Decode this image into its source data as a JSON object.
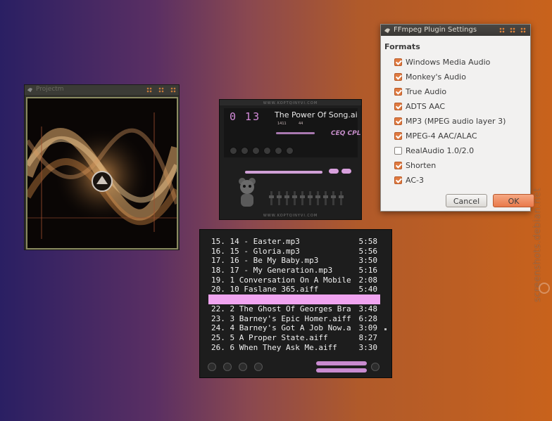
{
  "visualizer": {
    "title": "Projectm"
  },
  "player": {
    "brand_top": "WWW.KOPTQINYVI.COM",
    "brand_bottom": "WWW.KOPTQINYVI.COM",
    "time": "0 13",
    "song": "The Power Of Song.aiff",
    "kbps": "1411",
    "khz": "44",
    "mode": "CEQ CPL"
  },
  "playlist": {
    "items": [
      {
        "title": "15. 14 - Easter.mp3",
        "duration": "5:58"
      },
      {
        "title": "16. 15 - Gloria.mp3",
        "duration": "5:56"
      },
      {
        "title": "17. 16 - Be My Baby.mp3",
        "duration": "3:50"
      },
      {
        "title": "18. 17 - My Generation.mp3",
        "duration": "5:16"
      },
      {
        "title": "19. 1 Conversation On A Mobile...",
        "duration": "2:08"
      },
      {
        "title": "20. 10 Faslane 365.aiff",
        "duration": "5:40"
      },
      {
        "title": "",
        "duration": ""
      },
      {
        "title": "22. 2 The Ghost Of Georges Bra...",
        "duration": "3:48"
      },
      {
        "title": "23. 3 Barney's Epic Homer.aiff",
        "duration": "6:28"
      },
      {
        "title": "24. 4 Barney's Got A Job Now.a...",
        "duration": "3:09"
      },
      {
        "title": "25. 5 A Proper State.aiff",
        "duration": "8:27"
      },
      {
        "title": "26. 6 When They Ask Me.aiff",
        "duration": "3:30"
      }
    ],
    "selected_index": 6
  },
  "dialog": {
    "title": "FFmpeg Plugin Settings",
    "heading": "Formats",
    "formats": [
      {
        "label": "Windows Media Audio",
        "checked": true
      },
      {
        "label": "Monkey's Audio",
        "checked": true
      },
      {
        "label": "True Audio",
        "checked": true
      },
      {
        "label": "ADTS AAC",
        "checked": true
      },
      {
        "label": "MP3 (MPEG audio layer 3)",
        "checked": true
      },
      {
        "label": "MPEG-4 AAC/ALAC",
        "checked": true
      },
      {
        "label": "RealAudio 1.0/2.0",
        "checked": false
      },
      {
        "label": "Shorten",
        "checked": true
      },
      {
        "label": "AC-3",
        "checked": true
      }
    ],
    "cancel_label": "Cancel",
    "ok_label": "OK"
  },
  "watermark": "screenshots.debian.net",
  "colors": {
    "accent": "#e07a40",
    "playlist_selection": "#f0a4f0",
    "player_accent": "#d28ad8"
  }
}
